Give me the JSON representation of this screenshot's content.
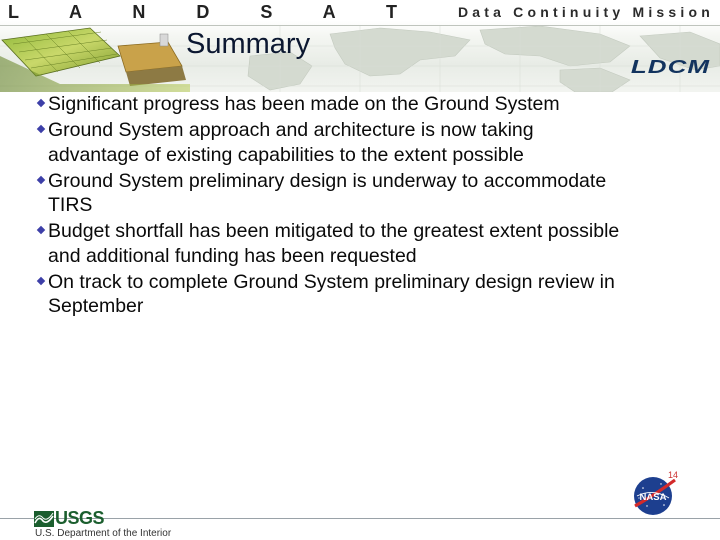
{
  "header": {
    "left_brand": "L A N D S A T",
    "right_brand": "Data Continuity Mission",
    "logo": "LDCM"
  },
  "slide": {
    "title": "Summary",
    "bullets": [
      {
        "lines": [
          "Significant progress has been made on the Ground System"
        ]
      },
      {
        "lines": [
          "Ground System approach and architecture is now taking",
          "advantage of existing capabilities to the extent possible"
        ]
      },
      {
        "lines": [
          "Ground System preliminary design is underway to accommodate",
          "TIRS"
        ]
      },
      {
        "lines": [
          "Budget shortfall has been mitigated to the greatest extent possible",
          "and additional funding has been requested"
        ]
      },
      {
        "lines": [
          "On track to complete Ground System preliminary design review in",
          "September"
        ]
      }
    ]
  },
  "footer": {
    "agency": "USGS",
    "department": "U.S. Department of the Interior",
    "page_number": "14",
    "nasa_logo": "NASA"
  },
  "icons": [
    "bullet-diamond-icon",
    "usgs-logo-icon",
    "nasa-meatball-icon",
    "landsat-satellite-icon",
    "world-map-background"
  ],
  "colors": {
    "title": "#0b1730",
    "bullet": "#3d3fa8",
    "ldcm": "#12335e",
    "usgs": "#1b5e2e"
  }
}
